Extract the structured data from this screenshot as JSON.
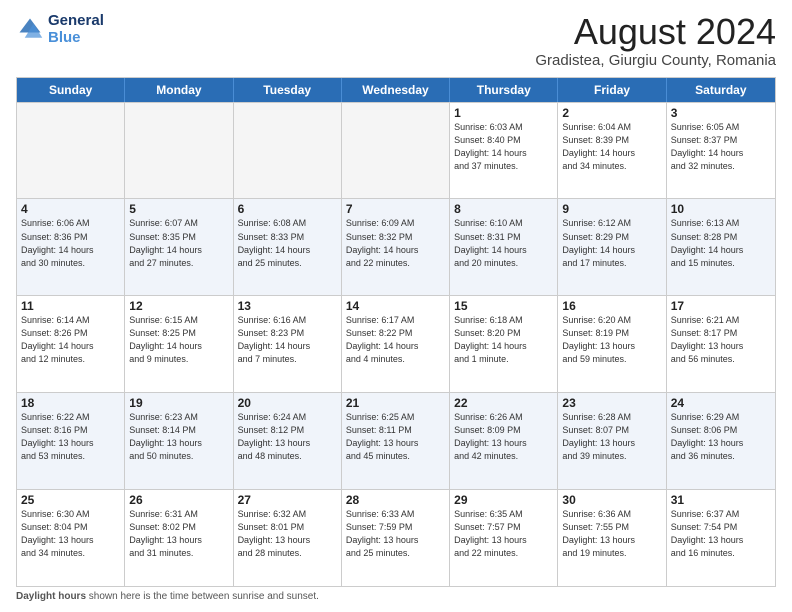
{
  "logo": {
    "line1": "General",
    "line2": "Blue"
  },
  "title": "August 2024",
  "subtitle": "Gradistea, Giurgiu County, Romania",
  "days_of_week": [
    "Sunday",
    "Monday",
    "Tuesday",
    "Wednesday",
    "Thursday",
    "Friday",
    "Saturday"
  ],
  "weeks": [
    [
      {
        "day": "",
        "info": "",
        "empty": true
      },
      {
        "day": "",
        "info": "",
        "empty": true
      },
      {
        "day": "",
        "info": "",
        "empty": true
      },
      {
        "day": "",
        "info": "",
        "empty": true
      },
      {
        "day": "1",
        "info": "Sunrise: 6:03 AM\nSunset: 8:40 PM\nDaylight: 14 hours\nand 37 minutes.",
        "empty": false
      },
      {
        "day": "2",
        "info": "Sunrise: 6:04 AM\nSunset: 8:39 PM\nDaylight: 14 hours\nand 34 minutes.",
        "empty": false
      },
      {
        "day": "3",
        "info": "Sunrise: 6:05 AM\nSunset: 8:37 PM\nDaylight: 14 hours\nand 32 minutes.",
        "empty": false
      }
    ],
    [
      {
        "day": "4",
        "info": "Sunrise: 6:06 AM\nSunset: 8:36 PM\nDaylight: 14 hours\nand 30 minutes.",
        "empty": false
      },
      {
        "day": "5",
        "info": "Sunrise: 6:07 AM\nSunset: 8:35 PM\nDaylight: 14 hours\nand 27 minutes.",
        "empty": false
      },
      {
        "day": "6",
        "info": "Sunrise: 6:08 AM\nSunset: 8:33 PM\nDaylight: 14 hours\nand 25 minutes.",
        "empty": false
      },
      {
        "day": "7",
        "info": "Sunrise: 6:09 AM\nSunset: 8:32 PM\nDaylight: 14 hours\nand 22 minutes.",
        "empty": false
      },
      {
        "day": "8",
        "info": "Sunrise: 6:10 AM\nSunset: 8:31 PM\nDaylight: 14 hours\nand 20 minutes.",
        "empty": false
      },
      {
        "day": "9",
        "info": "Sunrise: 6:12 AM\nSunset: 8:29 PM\nDaylight: 14 hours\nand 17 minutes.",
        "empty": false
      },
      {
        "day": "10",
        "info": "Sunrise: 6:13 AM\nSunset: 8:28 PM\nDaylight: 14 hours\nand 15 minutes.",
        "empty": false
      }
    ],
    [
      {
        "day": "11",
        "info": "Sunrise: 6:14 AM\nSunset: 8:26 PM\nDaylight: 14 hours\nand 12 minutes.",
        "empty": false
      },
      {
        "day": "12",
        "info": "Sunrise: 6:15 AM\nSunset: 8:25 PM\nDaylight: 14 hours\nand 9 minutes.",
        "empty": false
      },
      {
        "day": "13",
        "info": "Sunrise: 6:16 AM\nSunset: 8:23 PM\nDaylight: 14 hours\nand 7 minutes.",
        "empty": false
      },
      {
        "day": "14",
        "info": "Sunrise: 6:17 AM\nSunset: 8:22 PM\nDaylight: 14 hours\nand 4 minutes.",
        "empty": false
      },
      {
        "day": "15",
        "info": "Sunrise: 6:18 AM\nSunset: 8:20 PM\nDaylight: 14 hours\nand 1 minute.",
        "empty": false
      },
      {
        "day": "16",
        "info": "Sunrise: 6:20 AM\nSunset: 8:19 PM\nDaylight: 13 hours\nand 59 minutes.",
        "empty": false
      },
      {
        "day": "17",
        "info": "Sunrise: 6:21 AM\nSunset: 8:17 PM\nDaylight: 13 hours\nand 56 minutes.",
        "empty": false
      }
    ],
    [
      {
        "day": "18",
        "info": "Sunrise: 6:22 AM\nSunset: 8:16 PM\nDaylight: 13 hours\nand 53 minutes.",
        "empty": false
      },
      {
        "day": "19",
        "info": "Sunrise: 6:23 AM\nSunset: 8:14 PM\nDaylight: 13 hours\nand 50 minutes.",
        "empty": false
      },
      {
        "day": "20",
        "info": "Sunrise: 6:24 AM\nSunset: 8:12 PM\nDaylight: 13 hours\nand 48 minutes.",
        "empty": false
      },
      {
        "day": "21",
        "info": "Sunrise: 6:25 AM\nSunset: 8:11 PM\nDaylight: 13 hours\nand 45 minutes.",
        "empty": false
      },
      {
        "day": "22",
        "info": "Sunrise: 6:26 AM\nSunset: 8:09 PM\nDaylight: 13 hours\nand 42 minutes.",
        "empty": false
      },
      {
        "day": "23",
        "info": "Sunrise: 6:28 AM\nSunset: 8:07 PM\nDaylight: 13 hours\nand 39 minutes.",
        "empty": false
      },
      {
        "day": "24",
        "info": "Sunrise: 6:29 AM\nSunset: 8:06 PM\nDaylight: 13 hours\nand 36 minutes.",
        "empty": false
      }
    ],
    [
      {
        "day": "25",
        "info": "Sunrise: 6:30 AM\nSunset: 8:04 PM\nDaylight: 13 hours\nand 34 minutes.",
        "empty": false
      },
      {
        "day": "26",
        "info": "Sunrise: 6:31 AM\nSunset: 8:02 PM\nDaylight: 13 hours\nand 31 minutes.",
        "empty": false
      },
      {
        "day": "27",
        "info": "Sunrise: 6:32 AM\nSunset: 8:01 PM\nDaylight: 13 hours\nand 28 minutes.",
        "empty": false
      },
      {
        "day": "28",
        "info": "Sunrise: 6:33 AM\nSunset: 7:59 PM\nDaylight: 13 hours\nand 25 minutes.",
        "empty": false
      },
      {
        "day": "29",
        "info": "Sunrise: 6:35 AM\nSunset: 7:57 PM\nDaylight: 13 hours\nand 22 minutes.",
        "empty": false
      },
      {
        "day": "30",
        "info": "Sunrise: 6:36 AM\nSunset: 7:55 PM\nDaylight: 13 hours\nand 19 minutes.",
        "empty": false
      },
      {
        "day": "31",
        "info": "Sunrise: 6:37 AM\nSunset: 7:54 PM\nDaylight: 13 hours\nand 16 minutes.",
        "empty": false
      }
    ]
  ],
  "footer": {
    "label": "Daylight hours",
    "description": "Daylight hours"
  }
}
